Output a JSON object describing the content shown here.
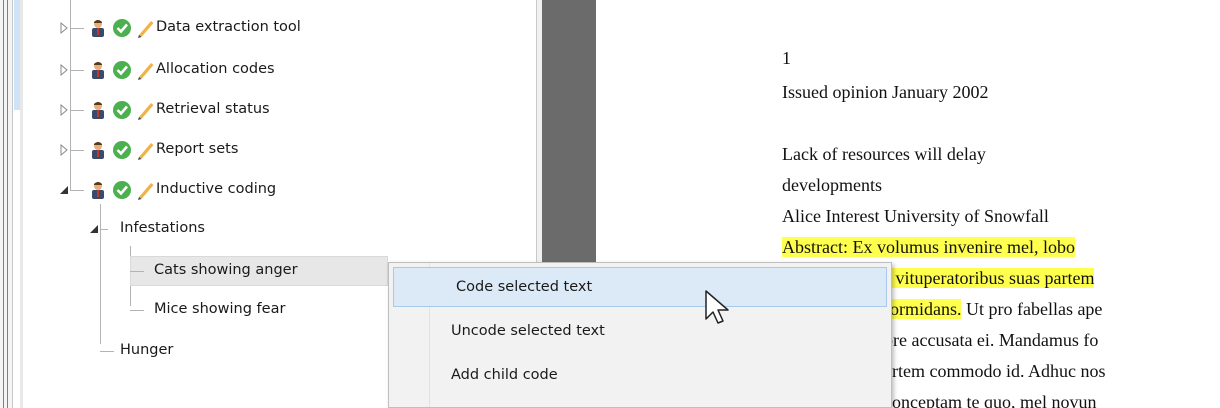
{
  "tree": {
    "items": [
      {
        "label": "Data extraction tool",
        "expanded": false
      },
      {
        "label": "Allocation codes",
        "expanded": false
      },
      {
        "label": "Retrieval status",
        "expanded": false
      },
      {
        "label": "Report sets",
        "expanded": false
      },
      {
        "label": "Inductive coding",
        "expanded": true
      }
    ],
    "children": {
      "infestations": "Infestations",
      "cats": "Cats showing anger",
      "mice": "Mice showing fear",
      "hunger": "Hunger"
    }
  },
  "document": {
    "lines": [
      "1",
      "Issued opinion January 2002",
      "Lack of resources will delay",
      "developments",
      "Alice Interest University of Snowfall",
      "Abstract: Ex volumus invenire mel, lobo",
      "s vituperatoribus suas partem",
      "formidans.",
      " Ut pro fabellas ape",
      "ore accusata ei. Mandamus fo",
      "artem commodo id. Adhuc nos",
      "conceptam te quo, mel novun"
    ],
    "highlight_color": "#ffff4d"
  },
  "context_menu": {
    "items": [
      "Code selected text",
      "Uncode selected text",
      "Add child code"
    ]
  },
  "colors": {
    "splitter_dark": "#6b6b6b",
    "menu_hover": "#dceaf8",
    "check_green": "#4caf50"
  }
}
